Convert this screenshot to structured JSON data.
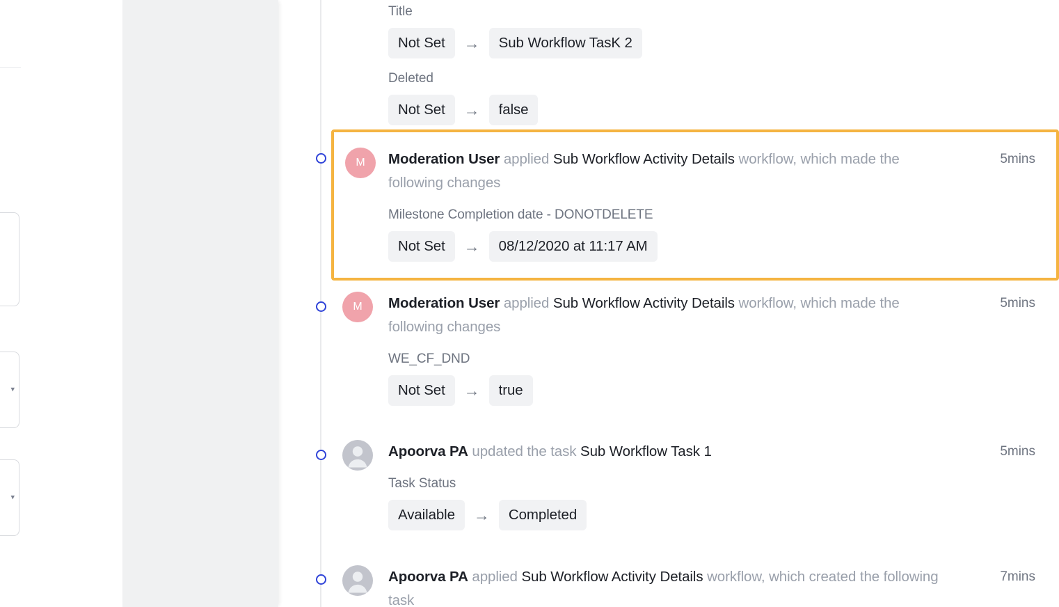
{
  "theme": {
    "highlight_border": "#f5b441",
    "marker_ring": "#2f43d8",
    "chip_bg": "#f1f2f4",
    "avatar_initial_bg": "#f0a3ab",
    "avatar_person_bg": "#c2c4cc",
    "panel_bg": "#f0f1f2",
    "muted_text": "#6e7480",
    "strong_text": "#1d2027"
  },
  "activity_feed": {
    "partial_top": {
      "field_label": "Title",
      "change": {
        "from": "Not Set",
        "to": "Sub Workflow TasK 2",
        "arrow": "→"
      },
      "field_label_2": "Deleted",
      "change_2": {
        "from": "Not Set",
        "to": "false",
        "arrow": "→"
      }
    },
    "entries": [
      {
        "avatar": {
          "type": "initial",
          "initial": "M"
        },
        "actor": "Moderation User",
        "verb": "applied",
        "entity": "Sub Workflow Activity Details",
        "suffix": "workflow, which made the following changes",
        "field_label": "Milestone Completion date - DONOTDELETE",
        "change": {
          "from": "Not Set",
          "to": "08/12/2020 at 11:17 AM",
          "arrow": "→"
        },
        "time": "5mins",
        "highlighted": true
      },
      {
        "avatar": {
          "type": "initial",
          "initial": "M"
        },
        "actor": "Moderation User",
        "verb": "applied",
        "entity": "Sub Workflow Activity Details",
        "suffix": "workflow, which made the following changes",
        "field_label": "WE_CF_DND",
        "change": {
          "from": "Not Set",
          "to": "true",
          "arrow": "→"
        },
        "time": "5mins",
        "highlighted": false
      },
      {
        "avatar": {
          "type": "person"
        },
        "actor": "Apoorva PA",
        "verb": "updated the task",
        "entity": "Sub Workflow Task 1",
        "suffix": "",
        "field_label": "Task Status",
        "change": {
          "from": "Available",
          "to": "Completed",
          "arrow": "→"
        },
        "time": "5mins",
        "highlighted": false
      }
    ],
    "partial_bottom": {
      "avatar": {
        "type": "person"
      },
      "actor": "Apoorva PA",
      "verb": "applied",
      "entity": "Sub Workflow Activity Details",
      "suffix": "workflow, which created the following task",
      "time": "7mins"
    }
  }
}
